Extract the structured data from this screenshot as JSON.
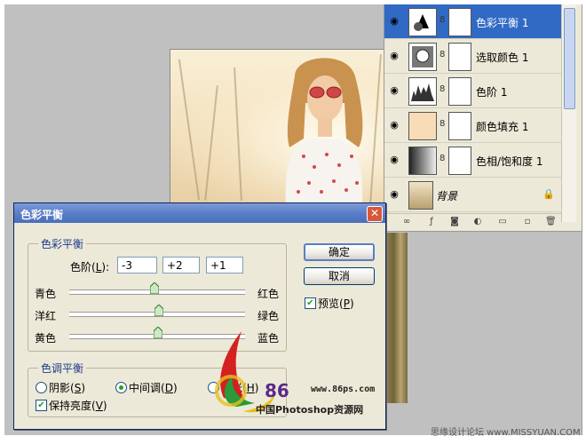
{
  "layers_panel": {
    "layers": [
      {
        "name": "色彩平衡 1",
        "selected": true,
        "thumb": "color-balance-adjustment-icon"
      },
      {
        "name": "选取颜色 1",
        "selected": false,
        "thumb": "selective-color-adjustment-icon"
      },
      {
        "name": "色阶 1",
        "selected": false,
        "thumb": "levels-histogram-icon"
      },
      {
        "name": "颜色填充 1",
        "selected": false,
        "thumb": "color-fill-swatch",
        "fill_color": "#f8dcb6"
      },
      {
        "name": "色相/饱和度 1",
        "selected": false,
        "thumb": "hue-saturation-gradient-icon"
      },
      {
        "name": "背景",
        "selected": false,
        "thumb": "photo-thumbnail"
      }
    ],
    "toolbar_icons": [
      "link-icon",
      "fx-icon",
      "mask-icon",
      "adjustment-icon",
      "folder-icon",
      "new-layer-icon",
      "trash-icon"
    ]
  },
  "dialog": {
    "title": "色彩平衡",
    "color_balance_group": "色彩平衡",
    "levels_label": "色阶(",
    "levels_key": "L",
    "levels_suffix": "):",
    "values": [
      "-3",
      "+2",
      "+1"
    ],
    "sliders": [
      {
        "left": "青色",
        "right": "红色",
        "value": -3
      },
      {
        "left": "洋红",
        "right": "绿色",
        "value": 2
      },
      {
        "left": "黄色",
        "right": "蓝色",
        "value": 1
      }
    ],
    "ok_label": "确定",
    "cancel_label": "取消",
    "preview_label": "预览(",
    "preview_key": "P",
    "preview_suffix": ")",
    "tone_group": "色调平衡",
    "tone_options": [
      {
        "label": "阴影(",
        "key": "S",
        "suffix": ")",
        "selected": false
      },
      {
        "label": "中间调(",
        "key": "D",
        "suffix": ")",
        "selected": true
      },
      {
        "label": "高光(",
        "key": "H",
        "suffix": ")",
        "selected": false
      }
    ],
    "preserve_label": "保持亮度(",
    "preserve_key": "V",
    "preserve_suffix": ")"
  },
  "watermark": {
    "brand_number": "86",
    "domain": "www.86ps.com",
    "subtitle": "中国Photoshop资源网"
  },
  "corner_watermark": "思缘设计论坛 www.MISSYUAN.COM",
  "colors": {
    "accent": "#316ac5",
    "title_bar": "#5a7ec7",
    "dialog_bg": "#ece9d8",
    "workspace": "#c0c0c0"
  }
}
